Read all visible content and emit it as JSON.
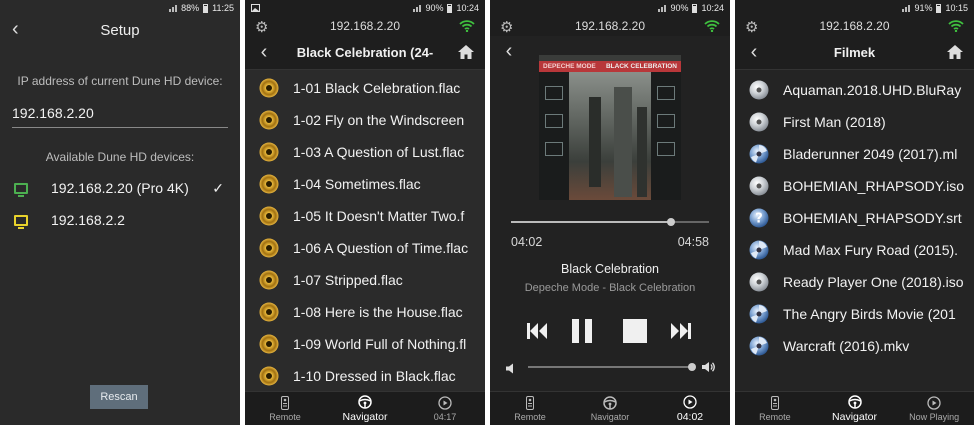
{
  "screens": {
    "setup": {
      "status": {
        "battery": "88%",
        "time": "11:25"
      },
      "title": "Setup",
      "ip_label": "IP address of current Dune HD device:",
      "ip_value": "192.168.2.20",
      "available_label": "Available Dune HD devices:",
      "devices": [
        {
          "label": "192.168.2.20 (Pro 4K)",
          "color": "#4caf50",
          "selected": true
        },
        {
          "label": "192.168.2.2",
          "color": "#e8d22c",
          "selected": false
        }
      ],
      "check_glyph": "✓",
      "rescan_label": "Rescan"
    },
    "browse": {
      "status": {
        "battery": "90%",
        "time": "10:24"
      },
      "ip": "192.168.2.20",
      "title": "Black Celebration (24-",
      "items": [
        "1-01 Black Celebration.flac",
        "1-02 Fly on the Windscreen",
        "1-03 A Question of Lust.flac",
        "1-04 Sometimes.flac",
        "1-05 It Doesn't Matter Two.f",
        "1-06 A Question of Time.flac",
        "1-07 Stripped.flac",
        "1-08 Here is the House.flac",
        "1-09 World Full of Nothing.fl",
        "1-10 Dressed in Black.flac"
      ],
      "tabs": {
        "remote": "Remote",
        "navigator": "Navigator",
        "playing": "04:17"
      }
    },
    "player": {
      "status": {
        "battery": "90%",
        "time": "10:24"
      },
      "ip": "192.168.2.20",
      "album_art": {
        "band": "DEPECHE MODE",
        "album": "BLACK CELEBRATION"
      },
      "elapsed": "04:02",
      "total": "04:58",
      "progress_fraction": 0.81,
      "track_title": "Black Celebration",
      "track_subtitle": "Depeche Mode - Black Celebration",
      "volume_fraction": 1.0,
      "tabs": {
        "remote": "Remote",
        "navigator": "Navigator",
        "playing": "04:02"
      }
    },
    "movies": {
      "status": {
        "battery": "91%",
        "time": "10:15"
      },
      "ip": "192.168.2.20",
      "title": "Filmek",
      "items": [
        {
          "label": "Aquaman.2018.UHD.BluRay",
          "icon": "disc-icon"
        },
        {
          "label": "First Man (2018)",
          "icon": "disc-icon"
        },
        {
          "label": "Bladerunner 2049 (2017).ml",
          "icon": "video-disc-icon"
        },
        {
          "label": "BOHEMIAN_RHAPSODY.iso",
          "icon": "disc-icon"
        },
        {
          "label": "BOHEMIAN_RHAPSODY.srt",
          "icon": "unknown-file-icon"
        },
        {
          "label": "Mad Max Fury Road (2015).",
          "icon": "video-disc-icon"
        },
        {
          "label": "Ready Player One (2018).iso",
          "icon": "disc-icon"
        },
        {
          "label": "The Angry Birds Movie (201",
          "icon": "video-disc-icon"
        },
        {
          "label": "Warcraft (2016).mkv",
          "icon": "video-disc-icon"
        }
      ],
      "tabs": {
        "remote": "Remote",
        "navigator": "Navigator",
        "playing": "Now Playing"
      }
    }
  },
  "colors": {
    "wifi": "#3fbf3f",
    "accent_button": "#5f6e7b"
  }
}
